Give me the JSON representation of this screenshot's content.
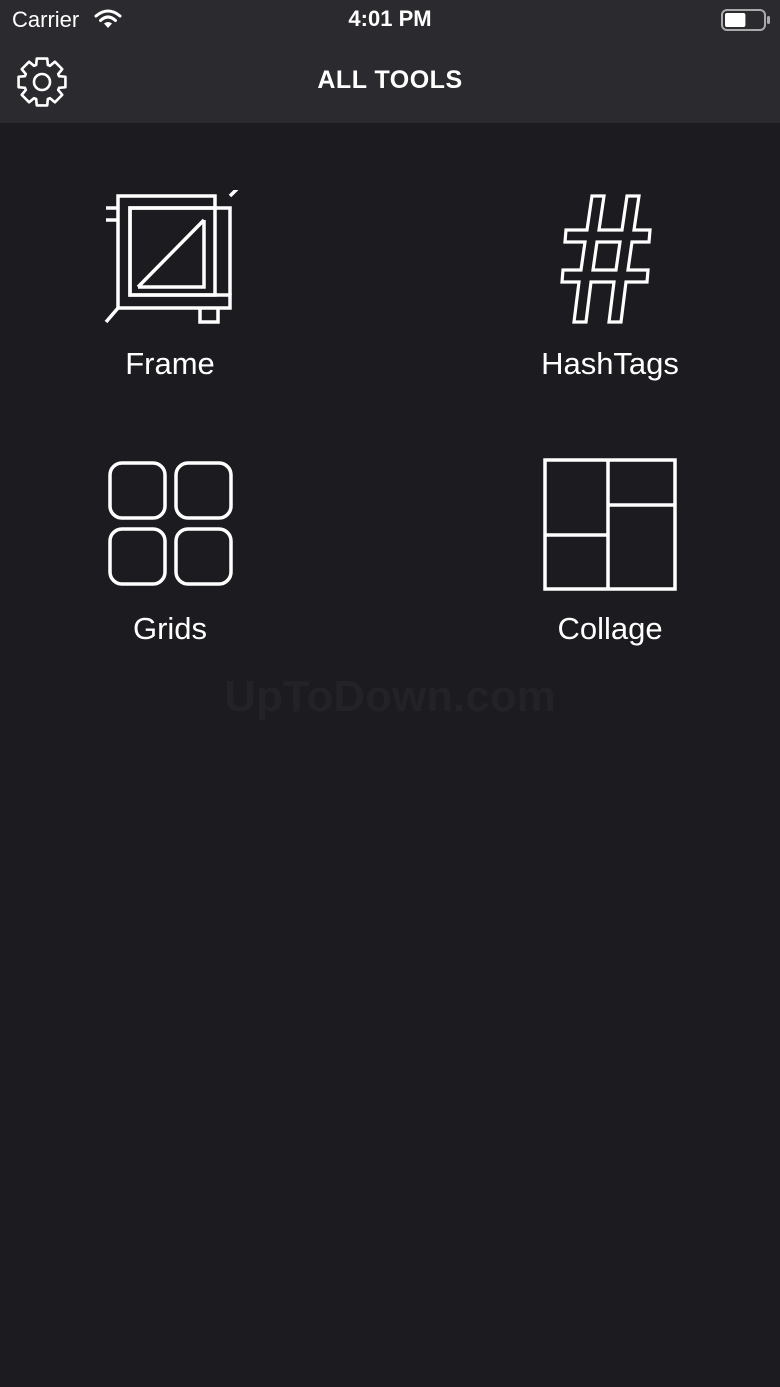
{
  "status_bar": {
    "carrier": "Carrier",
    "time": "4:01 PM",
    "wifi_icon": "wifi-icon",
    "battery_icon": "battery-icon",
    "battery_level": 0.55
  },
  "nav": {
    "title": "ALL TOOLS",
    "settings_icon": "gear-icon"
  },
  "tools": [
    {
      "label": "Frame",
      "icon": "crop-frame-icon"
    },
    {
      "label": "HashTags",
      "icon": "hashtag-icon"
    },
    {
      "label": "Grids",
      "icon": "grid-icon"
    },
    {
      "label": "Collage",
      "icon": "collage-icon"
    }
  ],
  "watermark": "UpToDown.com",
  "colors": {
    "background": "#1c1b20",
    "header": "#2b2a2f",
    "foreground": "#ffffff"
  }
}
